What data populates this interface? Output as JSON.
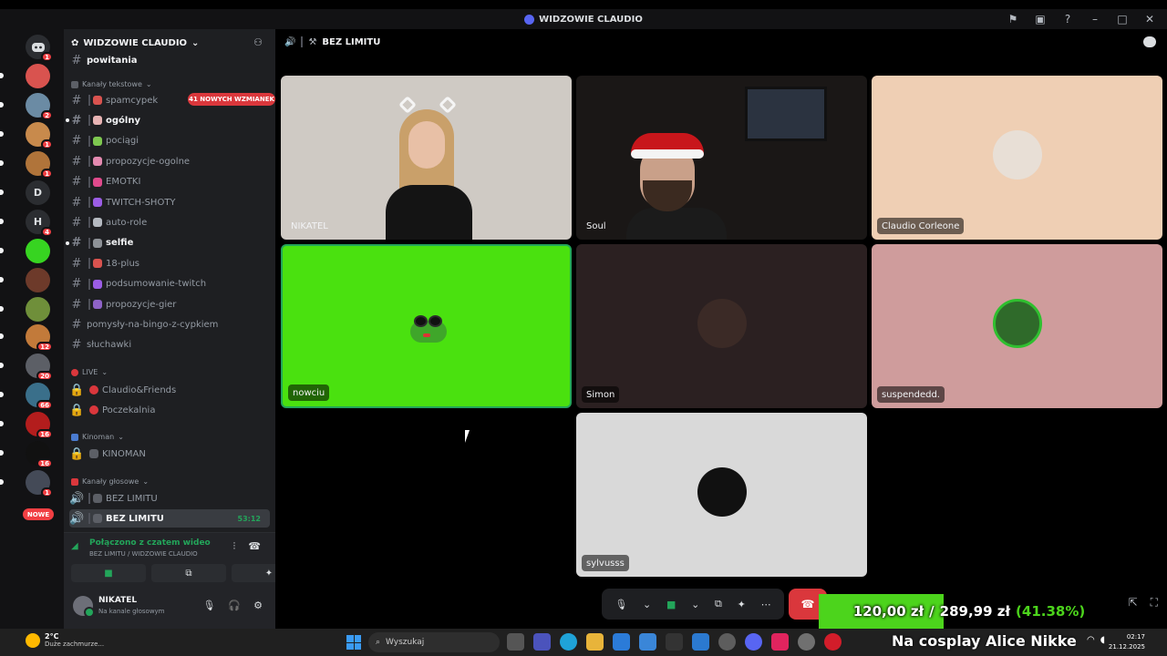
{
  "window": {
    "title": "WIDZOWIE CLAUDIO"
  },
  "server": {
    "name": "WIDZOWIE CLAUDIO",
    "mention_pill": "41 NOWYCH WZMIANEK",
    "top_partial_channel": "powitania"
  },
  "rail": {
    "items": [
      {
        "label": "",
        "badge": "1",
        "color": "#5865f2"
      },
      {
        "label": "",
        "badge": "",
        "color": "#d9534f"
      },
      {
        "label": "",
        "badge": "2",
        "color": "#6b8ba4"
      },
      {
        "label": "",
        "badge": "1",
        "color": "#c88a4c"
      },
      {
        "label": "",
        "badge": "1",
        "color": "#b0743a"
      },
      {
        "label": "D",
        "badge": "",
        "color": "#2b2d31"
      },
      {
        "label": "H",
        "badge": "4",
        "color": "#2b2d31"
      },
      {
        "label": "",
        "badge": "",
        "color": "#37d421"
      },
      {
        "label": "",
        "badge": "",
        "color": "#6d3a2a"
      },
      {
        "label": "",
        "badge": "",
        "color": "#6f8f3a"
      },
      {
        "label": "",
        "badge": "12",
        "color": "#c27a3a"
      },
      {
        "label": "",
        "badge": "20",
        "color": "#5c5f66"
      },
      {
        "label": "",
        "badge": "66",
        "color": "#3a6f8a"
      },
      {
        "label": "",
        "badge": "16",
        "color": "#b31d1d"
      },
      {
        "label": "",
        "badge": "16",
        "color": "#111111"
      },
      {
        "label": "",
        "badge": "1",
        "color": "#444a57"
      }
    ],
    "nowe_label": "NOWE"
  },
  "categories": {
    "text": "Kanały tekstowe",
    "live": "LIVE",
    "kinoman": "Kinoman",
    "voice": "Kanały głosowe"
  },
  "text_channels": [
    {
      "name": "spamcypek",
      "bold": false
    },
    {
      "name": "ogólny",
      "bold": true
    },
    {
      "name": "pociągi",
      "bold": false
    },
    {
      "name": "propozycje-ogolne",
      "bold": false
    },
    {
      "name": "EMOTKI",
      "bold": false
    },
    {
      "name": "TWITCH-SHOTY",
      "bold": false
    },
    {
      "name": "auto-role",
      "bold": false
    },
    {
      "name": "selfie",
      "bold": true
    },
    {
      "name": "18-plus",
      "bold": false
    },
    {
      "name": "podsumowanie-twitch",
      "bold": false
    },
    {
      "name": "propozycje-gier",
      "bold": false
    },
    {
      "name": "pomysły-na-bingo-z-cypkiem",
      "bold": false
    },
    {
      "name": "słuchawki",
      "bold": false
    }
  ],
  "live_channels": [
    "Claudio&Friends",
    "Poczekalnia"
  ],
  "kinoman_channels": [
    "KINOMAN"
  ],
  "voice_channels": [
    {
      "name": "BEZ LIMITU",
      "active": false,
      "timer": ""
    },
    {
      "name": "BEZ LIMITU",
      "active": true,
      "timer": "53:12"
    }
  ],
  "voice_panel": {
    "status": "Połączono z czatem wideo",
    "sub": "BEZ LIMITU / WIDZOWIE CLAUDIO"
  },
  "user": {
    "name": "NIKATEL",
    "status": "Na kanale głosowym"
  },
  "call": {
    "channel": "BEZ LIMITU"
  },
  "participants": [
    {
      "name": "NIKATEL",
      "kind": "camera1",
      "bg": "#cfcac4"
    },
    {
      "name": "Soul",
      "kind": "camera2",
      "bg": "#1a1716"
    },
    {
      "name": "Claudio Corleone",
      "kind": "avatar",
      "bg": "#efcfb4",
      "avatar_color": "#e8dfd6"
    },
    {
      "name": "nowciu",
      "kind": "frog",
      "bg": "#4ae10f"
    },
    {
      "name": "Simon",
      "kind": "avatar",
      "bg": "#2b2021",
      "avatar_color": "#3b2a26"
    },
    {
      "name": "suspendedd.",
      "kind": "avatar",
      "bg": "#cf9c9c",
      "avatar_color": "#2f6a2a"
    },
    {
      "name": "sylvusss",
      "kind": "avatar",
      "bg": "#d9d9d9",
      "avatar_color": "#111111"
    }
  ],
  "overlay": {
    "current": "120,00 zł",
    "separator": "/",
    "goal": "289,99 zł",
    "percent": "(41.38%)",
    "progress": 0.4138
  },
  "marquee": "Na cosplay Alice Nikke",
  "taskbar": {
    "weather_temp": "2°C",
    "weather_desc": "Duże zachmurze...",
    "search_placeholder": "Wyszukaj",
    "time": "02:17",
    "date": "21.12.2025"
  }
}
